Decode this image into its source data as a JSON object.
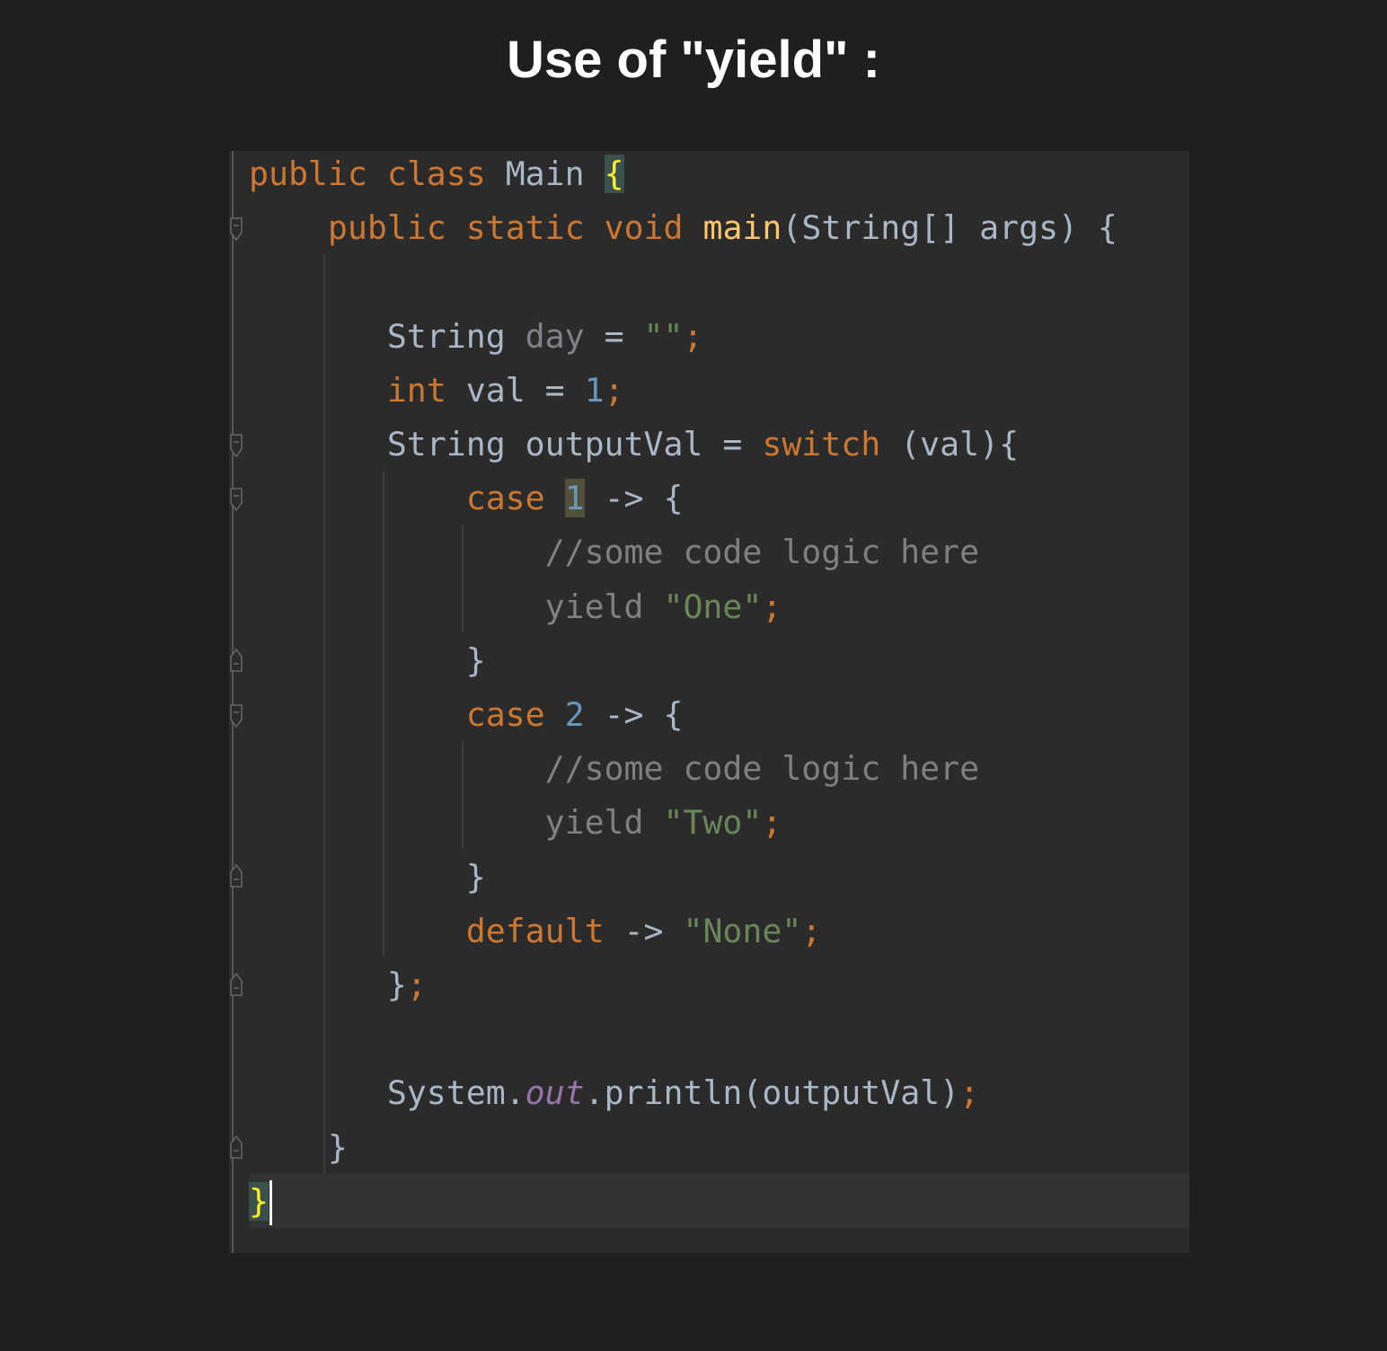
{
  "title": "Use of \"yield\" :",
  "code": {
    "language": "java",
    "lines": [
      {
        "tokens": [
          {
            "t": "public",
            "c": "kw"
          },
          {
            "t": " "
          },
          {
            "t": "class",
            "c": "kw"
          },
          {
            "t": " Main "
          },
          {
            "t": "{",
            "c": "brace-match"
          }
        ]
      },
      {
        "tokens": [
          {
            "t": "    "
          },
          {
            "t": "public",
            "c": "kw"
          },
          {
            "t": " "
          },
          {
            "t": "static",
            "c": "kw"
          },
          {
            "t": " "
          },
          {
            "t": "void",
            "c": "kw"
          },
          {
            "t": " "
          },
          {
            "t": "main",
            "c": "fn"
          },
          {
            "t": "(String[] args) {"
          }
        ]
      },
      {
        "tokens": []
      },
      {
        "tokens": [
          {
            "t": "       String "
          },
          {
            "t": "day",
            "c": "dim"
          },
          {
            "t": " = "
          },
          {
            "t": "\"\"",
            "c": "str"
          },
          {
            "t": ";",
            "c": "semi"
          }
        ]
      },
      {
        "tokens": [
          {
            "t": "       "
          },
          {
            "t": "int",
            "c": "kw"
          },
          {
            "t": " val = "
          },
          {
            "t": "1",
            "c": "num"
          },
          {
            "t": ";",
            "c": "semi"
          }
        ]
      },
      {
        "tokens": [
          {
            "t": "       String outputVal = "
          },
          {
            "t": "switch",
            "c": "kw"
          },
          {
            "t": " (val){"
          }
        ]
      },
      {
        "tokens": [
          {
            "t": "           "
          },
          {
            "t": "case",
            "c": "kw"
          },
          {
            "t": " "
          },
          {
            "t": "1",
            "c": "num num-hl"
          },
          {
            "t": " -> {"
          }
        ]
      },
      {
        "tokens": [
          {
            "t": "               "
          },
          {
            "t": "//some code logic here",
            "c": "cmt"
          }
        ]
      },
      {
        "tokens": [
          {
            "t": "               "
          },
          {
            "t": "yield",
            "c": "cmt"
          },
          {
            "t": " "
          },
          {
            "t": "\"One\"",
            "c": "str"
          },
          {
            "t": ";",
            "c": "semi"
          }
        ]
      },
      {
        "tokens": [
          {
            "t": "           }"
          }
        ]
      },
      {
        "tokens": [
          {
            "t": "           "
          },
          {
            "t": "case",
            "c": "kw"
          },
          {
            "t": " "
          },
          {
            "t": "2",
            "c": "num"
          },
          {
            "t": " -> {"
          }
        ]
      },
      {
        "tokens": [
          {
            "t": "               "
          },
          {
            "t": "//some code logic here",
            "c": "cmt"
          }
        ]
      },
      {
        "tokens": [
          {
            "t": "               "
          },
          {
            "t": "yield",
            "c": "cmt"
          },
          {
            "t": " "
          },
          {
            "t": "\"Two\"",
            "c": "str"
          },
          {
            "t": ";",
            "c": "semi"
          }
        ]
      },
      {
        "tokens": [
          {
            "t": "           }"
          }
        ]
      },
      {
        "tokens": [
          {
            "t": "           "
          },
          {
            "t": "default",
            "c": "kw"
          },
          {
            "t": " -> "
          },
          {
            "t": "\"None\"",
            "c": "str"
          },
          {
            "t": ";",
            "c": "semi"
          }
        ]
      },
      {
        "tokens": [
          {
            "t": "       }"
          },
          {
            "t": ";",
            "c": "semi"
          }
        ]
      },
      {
        "tokens": []
      },
      {
        "tokens": [
          {
            "t": "       System."
          },
          {
            "t": "out",
            "c": "static-field"
          },
          {
            "t": ".println(outputVal)"
          },
          {
            "t": ";",
            "c": "semi"
          }
        ]
      },
      {
        "tokens": [
          {
            "t": "    }"
          }
        ]
      },
      {
        "tokens": [
          {
            "t": "}",
            "c": "brace-match"
          },
          {
            "caret": true
          }
        ]
      }
    ]
  }
}
